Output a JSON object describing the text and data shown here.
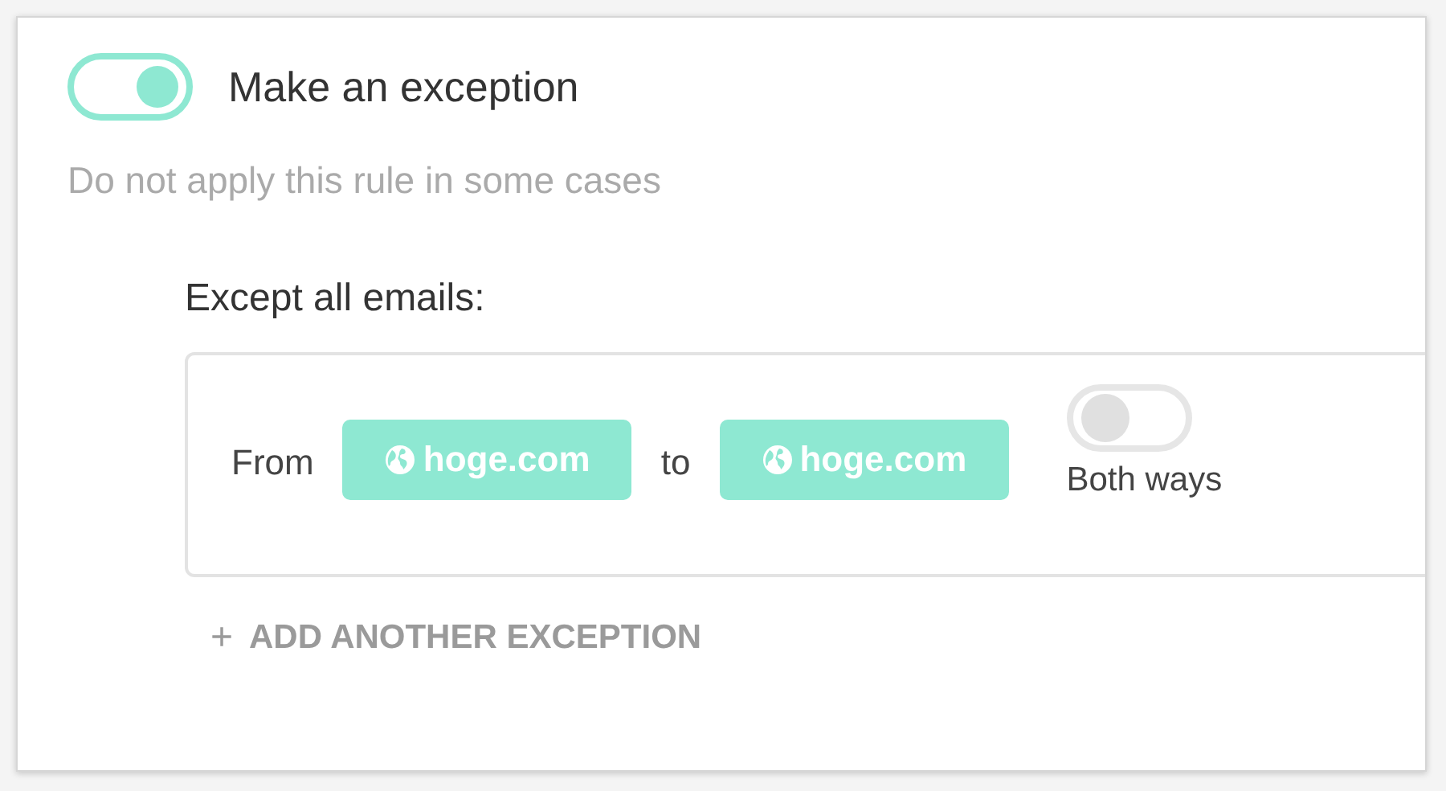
{
  "exception_toggle": {
    "label": "Make an exception",
    "on": true
  },
  "description": "Do not apply this rule in some cases",
  "section_title": "Except all emails:",
  "exception_rule": {
    "from_label": "From",
    "from_domain": "hoge.com",
    "to_label": "to",
    "to_domain": "hoge.com",
    "both_ways": {
      "label": "Both ways",
      "on": false
    }
  },
  "add_button": {
    "icon": "+",
    "label": "ADD ANOTHER EXCEPTION"
  }
}
